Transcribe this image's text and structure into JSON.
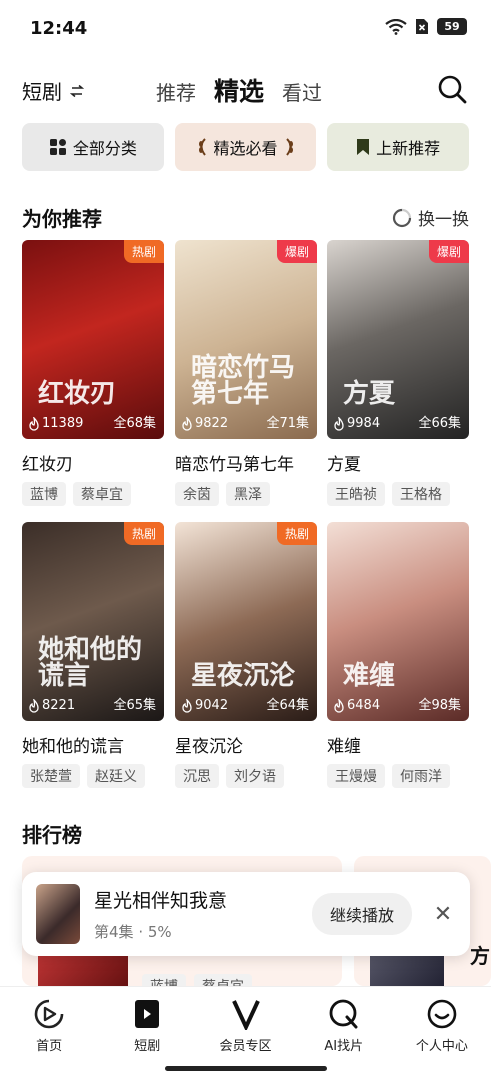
{
  "status": {
    "time": "12:44",
    "battery": "59"
  },
  "header": {
    "drama_label": "短剧",
    "swap_icon": "swap-icon",
    "tabs": [
      {
        "label": "推荐"
      },
      {
        "label": "精选"
      },
      {
        "label": "看过"
      }
    ],
    "active_tab": "精选"
  },
  "categories": [
    {
      "label": "全部分类",
      "icon": "grid-icon",
      "bg": "#e9e9e9"
    },
    {
      "label": "精选必看",
      "icon": "laurel-icon",
      "bg": "#f5e6dd"
    },
    {
      "label": "上新推荐",
      "icon": "bookmark-icon",
      "bg": "#e8ebde"
    }
  ],
  "recommend": {
    "title": "为你推荐",
    "refresh_label": "换一换",
    "cards": [
      {
        "title": "红妆刃",
        "badge": "热剧",
        "badge_type": "hot",
        "plays": "11389",
        "episodes": "全68集",
        "tags": [
          "蓝博",
          "蔡卓宜"
        ],
        "deco": "红妆刃"
      },
      {
        "title": "暗恋竹马第七年",
        "badge": "爆剧",
        "badge_type": "boom",
        "plays": "9822",
        "episodes": "全71集",
        "tags": [
          "余茵",
          "黑泽"
        ],
        "deco": "暗恋竹马第七年"
      },
      {
        "title": "方夏",
        "badge": "爆剧",
        "badge_type": "boom",
        "plays": "9984",
        "episodes": "全66集",
        "tags": [
          "王皓祯",
          "王格格"
        ],
        "deco": "方夏"
      },
      {
        "title": "她和他的谎言",
        "badge": "热剧",
        "badge_type": "hot",
        "plays": "8221",
        "episodes": "全65集",
        "tags": [
          "张楚萱",
          "赵廷义"
        ],
        "deco": "她和他的谎言"
      },
      {
        "title": "星夜沉沦",
        "badge": "热剧",
        "badge_type": "hot",
        "plays": "9042",
        "episodes": "全64集",
        "tags": [
          "沉思",
          "刘夕语"
        ],
        "deco": "星夜沉沦"
      },
      {
        "title": "难缠",
        "badge": "",
        "badge_type": "",
        "plays": "6484",
        "episodes": "全98集",
        "tags": [
          "王熳熳",
          "何雨洋"
        ],
        "deco": "难缠"
      }
    ]
  },
  "ranking": {
    "title": "排行榜",
    "peek_tags": [
      "蓝博",
      "蔡卓宜"
    ],
    "peek_right": "方"
  },
  "player": {
    "title": "星光相伴知我意",
    "episode": "第4集",
    "progress": "5%",
    "continue_label": "继续播放"
  },
  "nav": [
    {
      "label": "首页",
      "icon": "home-play-icon"
    },
    {
      "label": "短剧",
      "icon": "short-drama-icon"
    },
    {
      "label": "会员专区",
      "icon": "vip-icon"
    },
    {
      "label": "AI找片",
      "icon": "ai-search-icon"
    },
    {
      "label": "个人中心",
      "icon": "profile-icon"
    }
  ]
}
